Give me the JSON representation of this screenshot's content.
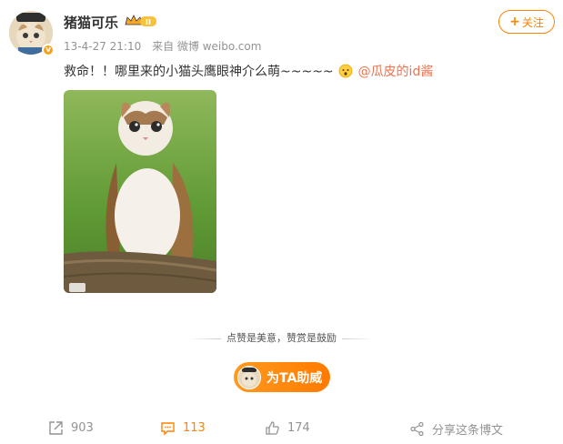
{
  "user": {
    "name": "猪猫可乐",
    "badge_level": "II",
    "time": "13-4-27 21:10",
    "source": "来自 微博 weibo.com"
  },
  "follow": {
    "label": "关注",
    "plus": "+"
  },
  "post": {
    "text": "救命！！哪里来的小猫头鹰眼神介么萌~~~~~",
    "mention": "@瓜皮的id酱"
  },
  "reward": {
    "tagline": "点赞是美意，赞赏是鼓励",
    "button_label": "为TA助威"
  },
  "actions": {
    "repost_count": "903",
    "comment_count": "113",
    "like_count": "174",
    "share_label": "分享这条博文"
  },
  "colors": {
    "accent": "#ff8200",
    "mention": "#eb7350",
    "meta": "#939393"
  }
}
